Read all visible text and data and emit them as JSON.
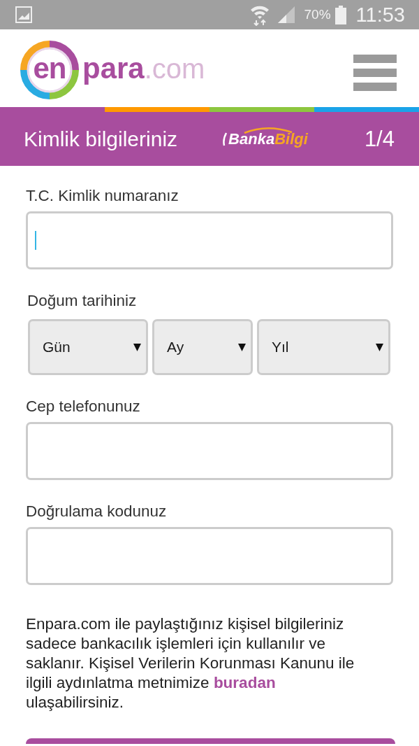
{
  "status_bar": {
    "battery": "70%",
    "time": "11:53"
  },
  "header": {
    "logo": [
      "en",
      "para",
      ".com"
    ]
  },
  "step_bar": {
    "title": "Kimlik bilgileriniz",
    "brand": [
      "Banka",
      "Bilgi"
    ],
    "step": "1/4"
  },
  "form": {
    "fields": [
      {
        "kind": "text",
        "label": "T.C. Kimlik numaranız",
        "focused": true
      },
      {
        "kind": "date",
        "label": "Doğum tarihiniz",
        "selects": [
          {
            "value": "Gün"
          },
          {
            "value": "Ay"
          },
          {
            "value": "Yıl"
          }
        ]
      },
      {
        "kind": "text",
        "label": "Cep telefonunuz",
        "focused": false
      },
      {
        "kind": "text",
        "label": "Doğrulama kodunuz",
        "focused": false
      }
    ]
  },
  "notice": {
    "text": "Enpara.com ile paylaştığınız kişisel bilgileriniz sadece bankacılık işlemleri için kullanılır ve saklanır. Kişisel Verilerin Korunması Kanunu ile ilgili aydınlatma metnimize",
    "link": "buradan",
    "text_after": "ulaşabilirsiniz."
  }
}
